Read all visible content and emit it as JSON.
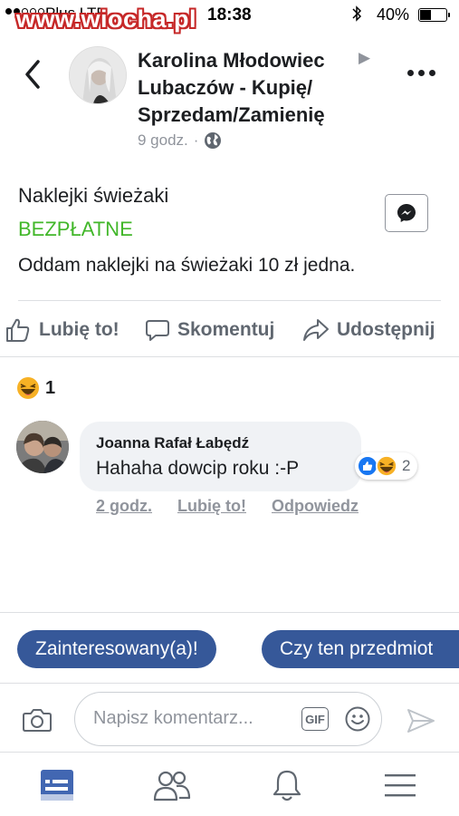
{
  "status_bar": {
    "carrier": "Plus  LTE",
    "watermark": "www.wiocha.pl",
    "time": "18:38",
    "battery_percent": "40%",
    "battery_level": 0.4
  },
  "post": {
    "author": "Karolina Młodowiec",
    "group": "Lubaczów - Kupię/ Sprzedam/Zamienię",
    "time_ago": "9 godz.",
    "separator": "·",
    "listing": {
      "title": "Naklejki świeżaki",
      "price": "BEZPŁATNE",
      "description": "Oddam naklejki na świeżaki 10 zł jedna."
    }
  },
  "actions": {
    "like": "Lubię to!",
    "comment": "Skomentuj",
    "share": "Udostępnij"
  },
  "reactions": {
    "count": "1"
  },
  "comment": {
    "author": "Joanna Rafał Łabędź",
    "text": "Hahaha dowcip roku :-P",
    "reaction_count": "2",
    "time_ago": "2 godz.",
    "like_link": "Lubię to!",
    "reply_link": "Odpowiedz"
  },
  "quick_replies": [
    "Zainteresowany(a)!",
    "Czy ten przedmiot"
  ],
  "composer": {
    "placeholder": "Napisz komentarz...",
    "gif_label": "GIF"
  },
  "colors": {
    "price_green": "#42b72a",
    "chip_blue": "#365899",
    "like_blue": "#1877f2",
    "nav_active": "#4267b2",
    "watermark_red": "#c62828"
  },
  "icons": [
    "back-chevron-icon",
    "globe-icon",
    "more-dots-icon",
    "messenger-icon",
    "thumbs-up-icon",
    "comment-icon",
    "share-icon",
    "haha-emoji-icon",
    "camera-icon",
    "gif-icon",
    "smiley-icon",
    "send-icon",
    "news-feed-icon",
    "friends-icon",
    "bell-icon",
    "menu-icon"
  ]
}
